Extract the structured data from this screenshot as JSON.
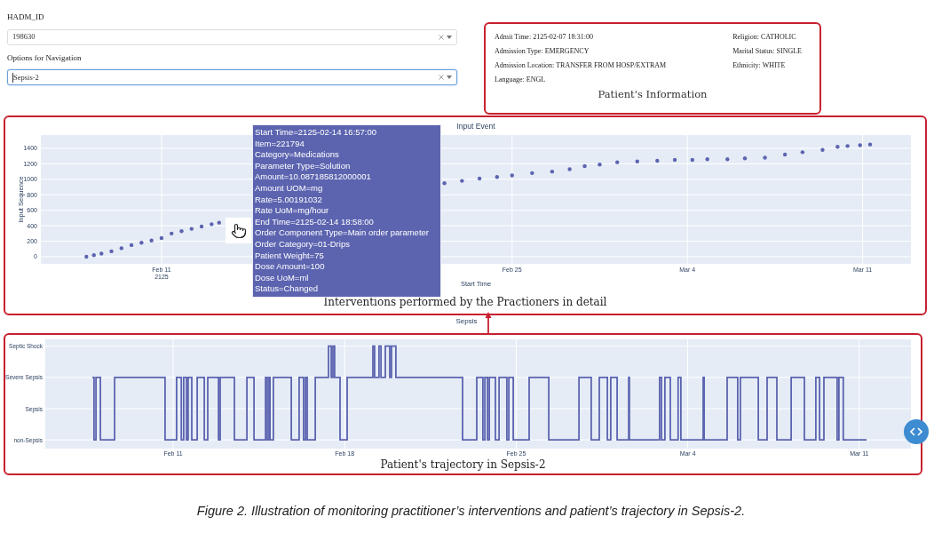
{
  "filters": [
    {
      "label": "HADM_ID",
      "value": "198630",
      "focused": false
    },
    {
      "label": "Options for Navigation",
      "value": "Sepsis-2",
      "focused": true
    }
  ],
  "patient_info": {
    "left": [
      "Admit Time: 2125-02-07 18:31:00",
      "Admission Type: EMERGENCY",
      "Admission Location: TRANSFER FROM HOSP/EXTRAM",
      "Language: ENGL"
    ],
    "right": [
      "Religion: CATHOLIC",
      "Marital Status: SINGLE",
      "Ethnicity: WHITE"
    ],
    "title": "Patient's Information"
  },
  "input_event": {
    "title": "Input Event",
    "xlabel": "Start Time",
    "ylabel": "Input Sequence",
    "caption": "Interventions performed by the Practioners in detail",
    "x_tick_labels": [
      "Feb 11\n2125",
      "Feb 25",
      "Mar 4",
      "Mar 11"
    ],
    "y_tick_labels": [
      "1400",
      "1200",
      "1000",
      "800",
      "600",
      "400",
      "200",
      "0"
    ],
    "tooltip": [
      "Start Time=2125-02-14 16:57:00",
      "Item=221794",
      "Category=Medications",
      "Parameter Type=Solution",
      "Amount=10.087185812000001",
      "Amount UOM=mg",
      "Rate=5.00191032",
      "Rate UoM=mg/hour",
      "End Time=2125-02-14 18:58:00",
      "Order Component Type=Main order parameter",
      "Order Category=01-Drips",
      "Patient Weight=75",
      "Dose Amount=100",
      "Dose UoM=ml",
      "Status=Changed"
    ]
  },
  "trajectory": {
    "title": "Sepsis",
    "caption": "Patient's trajectory in Sepsis-2",
    "x_tick_labels": [
      "Feb 11",
      "Feb 18",
      "Feb 25",
      "Mar 4",
      "Mar 11"
    ],
    "y_tick_labels": [
      "Septic Shock",
      "Severe Sepsis",
      "Sepsis",
      "non-Sepsis"
    ]
  },
  "figure_caption": "Figure 2. Illustration of monitoring practitioner’s interventions and patient’s trajectory in Sepsis-2."
}
